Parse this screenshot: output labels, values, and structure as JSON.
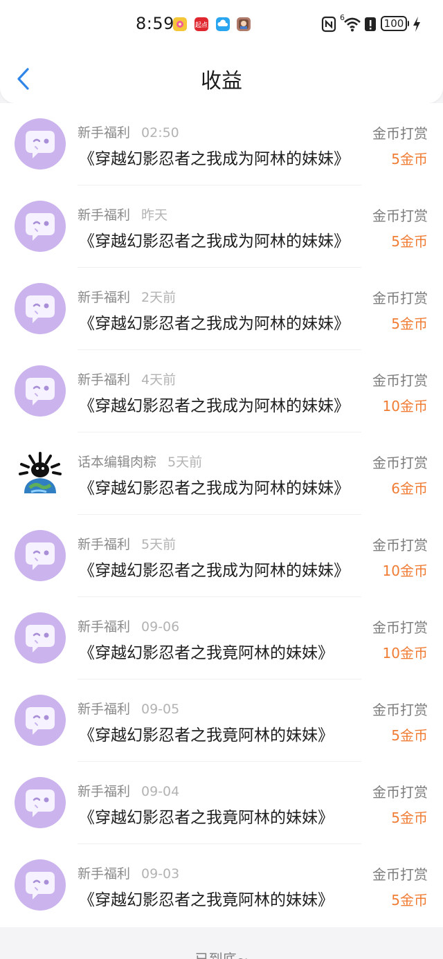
{
  "status_bar": {
    "time": "8:59",
    "app_icons": [
      {
        "name": "flower-app-icon",
        "color": "#f6c63a"
      },
      {
        "name": "qidian-app-icon",
        "label": "起点",
        "color": "#e0262f"
      },
      {
        "name": "cloud-app-icon",
        "color": "#2aa5f0"
      },
      {
        "name": "game-app-icon",
        "color": "#b07a6a"
      }
    ],
    "signal_label": "6",
    "battery": "100"
  },
  "header": {
    "title": "收益",
    "back_icon": "chevron-left-icon",
    "accent_color": "#2f86e8"
  },
  "rows": [
    {
      "sender": "新手福利",
      "time": "02:50",
      "title": "《穿越幻影忍者之我成为阿林的妹妹》",
      "type": "金币打赏",
      "amount": "5金币",
      "avatar": "chat-bubble-icon"
    },
    {
      "sender": "新手福利",
      "time": "昨天",
      "title": "《穿越幻影忍者之我成为阿林的妹妹》",
      "type": "金币打赏",
      "amount": "5金币",
      "avatar": "chat-bubble-icon"
    },
    {
      "sender": "新手福利",
      "time": "2天前",
      "title": "《穿越幻影忍者之我成为阿林的妹妹》",
      "type": "金币打赏",
      "amount": "5金币",
      "avatar": "chat-bubble-icon"
    },
    {
      "sender": "新手福利",
      "time": "4天前",
      "title": "《穿越幻影忍者之我成为阿林的妹妹》",
      "type": "金币打赏",
      "amount": "10金币",
      "avatar": "chat-bubble-icon"
    },
    {
      "sender": "话本编辑肉粽",
      "time": "5天前",
      "title": "《穿越幻影忍者之我成为阿林的妹妹》",
      "type": "金币打赏",
      "amount": "6金币",
      "avatar": "user-photo-avatar"
    },
    {
      "sender": "新手福利",
      "time": "5天前",
      "title": "《穿越幻影忍者之我成为阿林的妹妹》",
      "type": "金币打赏",
      "amount": "10金币",
      "avatar": "chat-bubble-icon"
    },
    {
      "sender": "新手福利",
      "time": "09-06",
      "title": "《穿越幻影忍者之我竟阿林的妹妹》",
      "type": "金币打赏",
      "amount": "10金币",
      "avatar": "chat-bubble-icon"
    },
    {
      "sender": "新手福利",
      "time": "09-05",
      "title": "《穿越幻影忍者之我竟阿林的妹妹》",
      "type": "金币打赏",
      "amount": "5金币",
      "avatar": "chat-bubble-icon"
    },
    {
      "sender": "新手福利",
      "time": "09-04",
      "title": "《穿越幻影忍者之我竟阿林的妹妹》",
      "type": "金币打赏",
      "amount": "5金币",
      "avatar": "chat-bubble-icon"
    },
    {
      "sender": "新手福利",
      "time": "09-03",
      "title": "《穿越幻影忍者之我竟阿林的妹妹》",
      "type": "金币打赏",
      "amount": "5金币",
      "avatar": "chat-bubble-icon"
    }
  ],
  "footer": {
    "text": "已到底~"
  },
  "colors": {
    "amount": "#f07c34",
    "avatar_bg": "#cbb4ee",
    "page_bg": "#f4f4f6"
  }
}
